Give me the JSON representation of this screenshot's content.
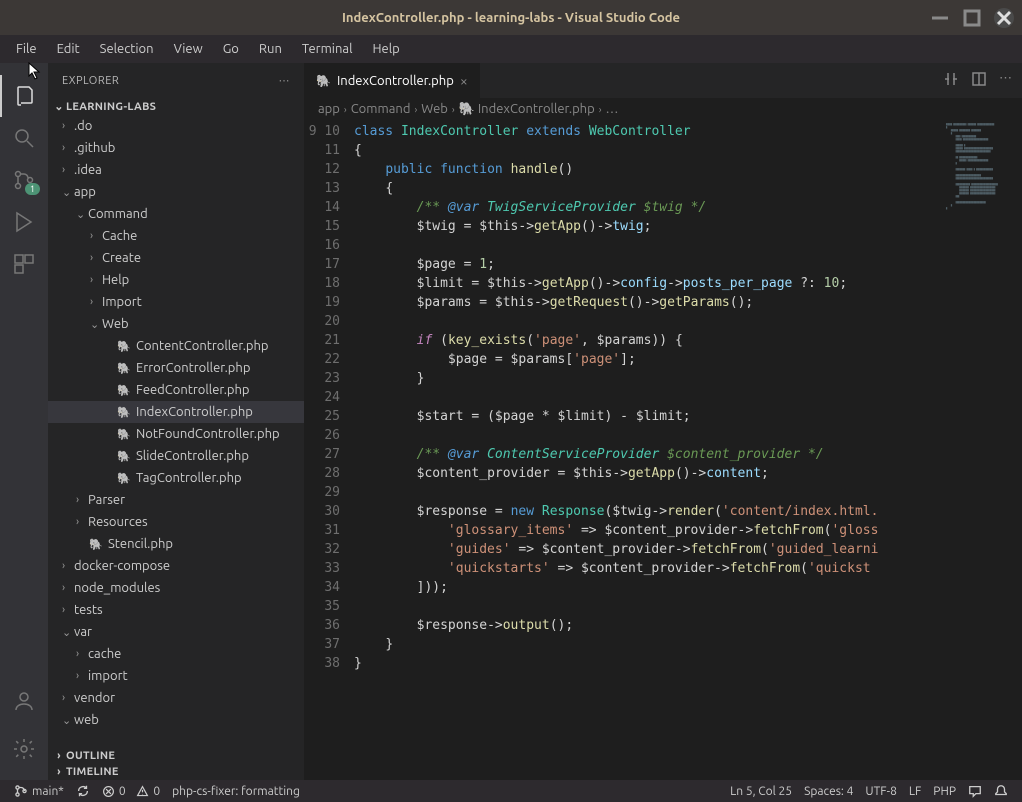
{
  "title": "IndexController.php - learning-labs - Visual Studio Code",
  "menu": [
    "File",
    "Edit",
    "Selection",
    "View",
    "Go",
    "Run",
    "Terminal",
    "Help"
  ],
  "explorer": {
    "title": "EXPLORER",
    "project": "LEARNING-LABS",
    "outline": "OUTLINE",
    "timeline": "TIMELINE"
  },
  "scm_badge": "1",
  "tree": [
    {
      "depth": 0,
      "name": ".do",
      "type": "dir",
      "open": false
    },
    {
      "depth": 0,
      "name": ".github",
      "type": "dir",
      "open": false
    },
    {
      "depth": 0,
      "name": ".idea",
      "type": "dir",
      "open": false
    },
    {
      "depth": 0,
      "name": "app",
      "type": "dir",
      "open": true
    },
    {
      "depth": 1,
      "name": "Command",
      "type": "dir",
      "open": true
    },
    {
      "depth": 2,
      "name": "Cache",
      "type": "dir",
      "open": false
    },
    {
      "depth": 2,
      "name": "Create",
      "type": "dir",
      "open": false
    },
    {
      "depth": 2,
      "name": "Help",
      "type": "dir",
      "open": false
    },
    {
      "depth": 2,
      "name": "Import",
      "type": "dir",
      "open": false
    },
    {
      "depth": 2,
      "name": "Web",
      "type": "dir",
      "open": true
    },
    {
      "depth": 3,
      "name": "ContentController.php",
      "type": "php"
    },
    {
      "depth": 3,
      "name": "ErrorController.php",
      "type": "php"
    },
    {
      "depth": 3,
      "name": "FeedController.php",
      "type": "php"
    },
    {
      "depth": 3,
      "name": "IndexController.php",
      "type": "php",
      "selected": true
    },
    {
      "depth": 3,
      "name": "NotFoundController.php",
      "type": "php"
    },
    {
      "depth": 3,
      "name": "SlideController.php",
      "type": "php"
    },
    {
      "depth": 3,
      "name": "TagController.php",
      "type": "php"
    },
    {
      "depth": 1,
      "name": "Parser",
      "type": "dir",
      "open": false
    },
    {
      "depth": 1,
      "name": "Resources",
      "type": "dir",
      "open": false
    },
    {
      "depth": 1,
      "name": "Stencil.php",
      "type": "php"
    },
    {
      "depth": 0,
      "name": "docker-compose",
      "type": "dir",
      "open": false
    },
    {
      "depth": 0,
      "name": "node_modules",
      "type": "dir",
      "open": false
    },
    {
      "depth": 0,
      "name": "tests",
      "type": "dir",
      "open": false
    },
    {
      "depth": 0,
      "name": "var",
      "type": "dir",
      "open": true
    },
    {
      "depth": 1,
      "name": "cache",
      "type": "dir",
      "open": false
    },
    {
      "depth": 1,
      "name": "import",
      "type": "dir",
      "open": false
    },
    {
      "depth": 0,
      "name": "vendor",
      "type": "dir",
      "open": false
    },
    {
      "depth": 0,
      "name": "web",
      "type": "dir",
      "open": true
    }
  ],
  "tab": {
    "label": "IndexController.php"
  },
  "breadcrumb": [
    "app",
    "Command",
    "Web",
    "IndexController.php",
    "…"
  ],
  "line_start": 9,
  "line_end": 38,
  "code_lines": [
    "<span class='kw2'>class</span> <span class='type'>IndexController</span> <span class='kw2'>extends</span> <span class='type'>WebController</span>",
    "<span class='pun'>{</span>",
    "    <span class='kw2'>public</span> <span class='kw2'>function</span> <span class='fn'>handle</span><span class='pun'>()</span>",
    "    <span class='pun'>{</span>",
    "        <span class='cmt'>/** <span class='doctag'>@var</span> <span class='docvar'>TwigServiceProvider</span> $twig */</span>",
    "        <span class='var'>$twig</span> <span class='op'>=</span> <span class='var'>$this</span><span class='op'>-></span><span class='fn'>getApp</span><span class='pun'>()</span><span class='op'>-></span><span class='prop'>twig</span><span class='pun'>;</span>",
    "",
    "        <span class='var'>$page</span> <span class='op'>=</span> <span class='num'>1</span><span class='pun'>;</span>",
    "        <span class='var'>$limit</span> <span class='op'>=</span> <span class='var'>$this</span><span class='op'>-></span><span class='fn'>getApp</span><span class='pun'>()</span><span class='op'>-></span><span class='prop'>config</span><span class='op'>-></span><span class='prop'>posts_per_page</span> <span class='op'>?:</span> <span class='num'>10</span><span class='pun'>;</span>",
    "        <span class='var'>$params</span> <span class='op'>=</span> <span class='var'>$this</span><span class='op'>-></span><span class='fn'>getRequest</span><span class='pun'>()</span><span class='op'>-></span><span class='fn'>getParams</span><span class='pun'>();</span>",
    "",
    "        <span class='kw'>if</span> <span class='pun'>(</span><span class='fn'>key_exists</span><span class='pun'>(</span><span class='str'>'page'</span><span class='pun'>,</span> <span class='var'>$params</span><span class='pun'>))</span> <span class='pun'>{</span>",
    "            <span class='var'>$page</span> <span class='op'>=</span> <span class='var'>$params</span><span class='pun'>[</span><span class='str'>'page'</span><span class='pun'>];</span>",
    "        <span class='pun'>}</span>",
    "",
    "        <span class='var'>$start</span> <span class='op'>=</span> <span class='pun'>(</span><span class='var'>$page</span> <span class='op'>*</span> <span class='var'>$limit</span><span class='pun'>)</span> <span class='op'>-</span> <span class='var'>$limit</span><span class='pun'>;</span>",
    "",
    "        <span class='cmt'>/** <span class='doctag'>@var</span> <span class='docvar'>ContentServiceProvider</span> $content_provider */</span>",
    "        <span class='var'>$content_provider</span> <span class='op'>=</span> <span class='var'>$this</span><span class='op'>-></span><span class='fn'>getApp</span><span class='pun'>()</span><span class='op'>-></span><span class='prop'>content</span><span class='pun'>;</span>",
    "",
    "        <span class='var'>$response</span> <span class='op'>=</span> <span class='kw2'>new</span> <span class='type'>Response</span><span class='pun'>(</span><span class='var'>$twig</span><span class='op'>-></span><span class='fn'>render</span><span class='pun'>(</span><span class='str'>'content/index.html.</span>",
    "            <span class='str'>'glossary_items'</span> <span class='op'>=></span> <span class='var'>$content_provider</span><span class='op'>-></span><span class='fn'>fetchFrom</span><span class='pun'>(</span><span class='str'>'gloss</span>",
    "            <span class='str'>'guides'</span> <span class='op'>=></span> <span class='var'>$content_provider</span><span class='op'>-></span><span class='fn'>fetchFrom</span><span class='pun'>(</span><span class='str'>'guided_learni</span>",
    "            <span class='str'>'quickstarts'</span> <span class='op'>=></span> <span class='var'>$content_provider</span><span class='op'>-></span><span class='fn'>fetchFrom</span><span class='pun'>(</span><span class='str'>'quickst</span>",
    "        <span class='pun'>]));</span>",
    "",
    "        <span class='var'>$response</span><span class='op'>-></span><span class='fn'>output</span><span class='pun'>();</span>",
    "    <span class='pun'>}</span>",
    "<span class='pun'>}</span>",
    ""
  ],
  "status": {
    "branch": "main*",
    "errors": "0",
    "warnings": "0",
    "formatter": "php-cs-fixer: formatting",
    "lncol": "Ln 5, Col 25",
    "spaces": "Spaces: 4",
    "encoding": "UTF-8",
    "eol": "LF",
    "lang": "PHP"
  }
}
